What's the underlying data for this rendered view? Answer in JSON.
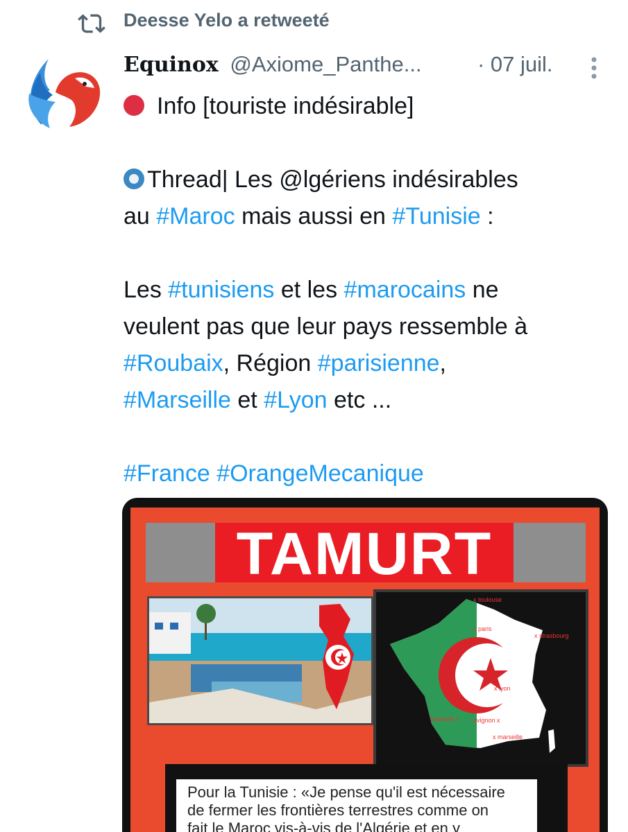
{
  "retweet": {
    "icon": "retweet-icon",
    "label": "Deesse Yelo a retweeté"
  },
  "author": {
    "display_name": "Equinox",
    "handle": "@Axiome_Panthe...",
    "date": "· 07 juil.",
    "avatar_icon": "bird-logo-icon"
  },
  "tweet": {
    "line1": "Info [touriste indésirable]",
    "line2a": "Thread| Les @lgériens indésirables",
    "line3a": "au ",
    "tag_maroc": "#Maroc",
    "line3b": " mais aussi en ",
    "tag_tunisie": "#Tunisie",
    "line3c": " :",
    "line4a": "Les ",
    "tag_tunisiens": "#tunisiens",
    "line4b": " et les ",
    "tag_marocains": "#marocains",
    "line4c": " ne",
    "line5": "veulent pas que leur pays ressemble à",
    "tag_roubaix": "#Roubaix",
    "line6a": ", Région ",
    "tag_parisienne": "#parisienne",
    "line6b": ",",
    "tag_marseille": "#Marseille",
    "line7a": " et ",
    "tag_lyon": "#Lyon",
    "line7b": " etc ...",
    "tag_france": "#France",
    "tag_orange": "#OrangeMecanique"
  },
  "media": {
    "banner": "TAMURT",
    "map_labels": [
      "x toulouse",
      "x paris",
      "x strasbourg",
      "x lyon",
      "toulouse x",
      "avignon x",
      "x marseille"
    ],
    "quote_lines": [
      "Pour la Tunisie :  «Je pense qu'il est nécessaire",
      "de fermer les frontières terrestres comme on",
      "fait le Maroc vis-à-vis de l'Algérie et en y"
    ]
  },
  "colors": {
    "link": "#1d9bf0",
    "muted": "#536471",
    "banner_red": "#ea1c24",
    "frame": "#ea4a2e"
  }
}
